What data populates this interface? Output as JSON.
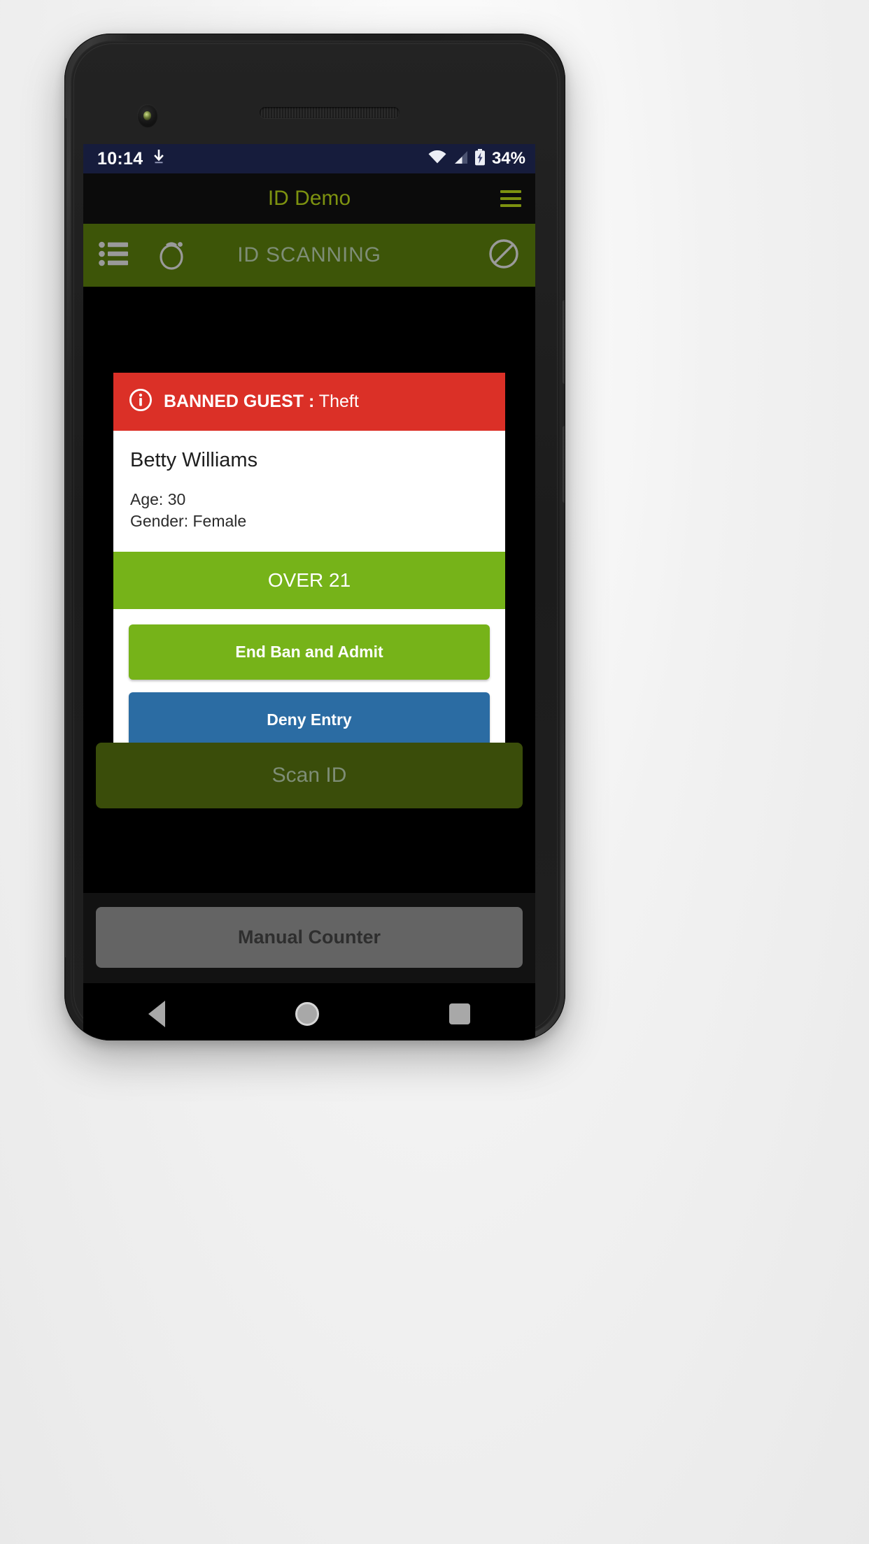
{
  "status_bar": {
    "time": "10:14",
    "download_icon": "download-icon",
    "wifi_icon": "wifi-icon",
    "signal_icon": "cellular-signal-icon",
    "battery_icon": "battery-charging-icon",
    "battery_percent": "34%",
    "background_color": "#161c3c"
  },
  "app_bar": {
    "title": "ID Demo",
    "menu_icon": "hamburger-menu-icon",
    "title_color": "#7d9210",
    "background_color": "#0b0b0b"
  },
  "toolbar": {
    "title": "ID SCANNING",
    "list_icon": "list-icon",
    "timer_icon": "timer-icon",
    "block_icon": "no-entry-icon",
    "background_color": "#3d5508",
    "text_color": "#7e8d76"
  },
  "card": {
    "banner": {
      "info_icon": "info-circle-icon",
      "label": "BANNED GUEST :",
      "reason": "Theft",
      "background_color": "#db3027"
    },
    "person": {
      "name": "Betty Williams",
      "age_line": "Age: 30",
      "gender_line": "Gender: Female"
    },
    "age_status": {
      "label": "OVER 21",
      "background_color": "#76b319"
    },
    "actions": [
      {
        "label": "End Ban and Admit",
        "color": "#76b319"
      },
      {
        "label": "Deny Entry",
        "color": "#2b6ca3"
      }
    ]
  },
  "scan_button": {
    "label": "Scan ID",
    "background_color": "#3a4d0a",
    "text_color": "#7e8d76"
  },
  "counter_button": {
    "label": "Manual Counter",
    "background_color": "#646464",
    "text_color": "#2e2e2e"
  },
  "nav_bar": {
    "back_icon": "back-triangle-icon",
    "home_icon": "home-circle-icon",
    "recents_icon": "recents-square-icon"
  }
}
